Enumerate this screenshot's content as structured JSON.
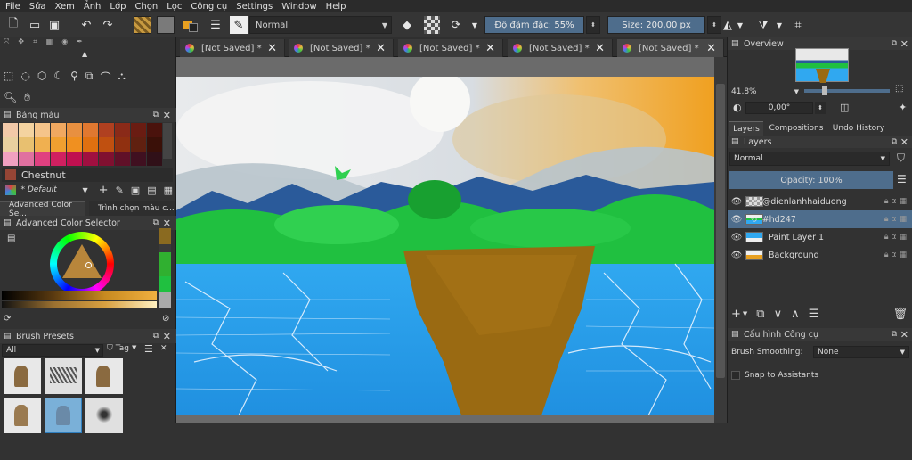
{
  "menu": [
    "File",
    "Sửa",
    "Xem",
    "Ảnh",
    "Lớp",
    "Chọn",
    "Lọc",
    "Công cụ",
    "Settings",
    "Window",
    "Help"
  ],
  "toolbar": {
    "blend_mode": "Normal",
    "opacity_label": "Độ đậm đặc: 55%",
    "size_label": "Size: 200,00 px"
  },
  "tabs": [
    {
      "label": "[Not Saved]  *"
    },
    {
      "label": "[Not Saved]  *"
    },
    {
      "label": "[Not Saved]  *"
    },
    {
      "label": "[Not Saved]  *"
    },
    {
      "label": "[Not Saved]  *"
    }
  ],
  "left": {
    "palette_title": "Bảng màu",
    "current_color": "Chestnut",
    "palette_name": "* Default",
    "tab1": "Advanced Color Se...",
    "tab2": "Trình chọn màu c...",
    "acs_title": "Advanced Color Selector",
    "brush_title": "Brush Presets",
    "brush_filter": "All",
    "brush_tag": "Tag"
  },
  "palette_colors": [
    "#f2c9a8",
    "#f4d3a0",
    "#f5c48a",
    "#f0a860",
    "#e89040",
    "#e07830",
    "#b04020",
    "#8a2a18",
    "#6a1c12",
    "#4a120c",
    "#e8d0a0",
    "#e8c070",
    "#f0b050",
    "#f0a030",
    "#f09020",
    "#e07010",
    "#c05010",
    "#903010",
    "#602010",
    "#3a1008",
    "#f0a0c0",
    "#e070a0",
    "#e04080",
    "#d02060",
    "#c01050",
    "#a01040",
    "#801030",
    "#601028",
    "#401020",
    "#301018"
  ],
  "right": {
    "overview_title": "Overview",
    "zoom": "41,8%",
    "rotation": "0,00°",
    "tabs": [
      "Layers",
      "Compositions",
      "Undo History"
    ],
    "layers_title": "Layers",
    "layers_blend": "Normal",
    "layers_opacity": "Opacity:  100%",
    "layers": [
      {
        "name": "@dienlanhhaiduong"
      },
      {
        "name": "#hd247"
      },
      {
        "name": "Paint Layer 1"
      },
      {
        "name": "Background"
      }
    ],
    "tool_title": "Cấu hình Công cụ",
    "smoothing_label": "Brush Smoothing:",
    "smoothing_value": "None",
    "snap_label": "Snap to Assistants"
  }
}
